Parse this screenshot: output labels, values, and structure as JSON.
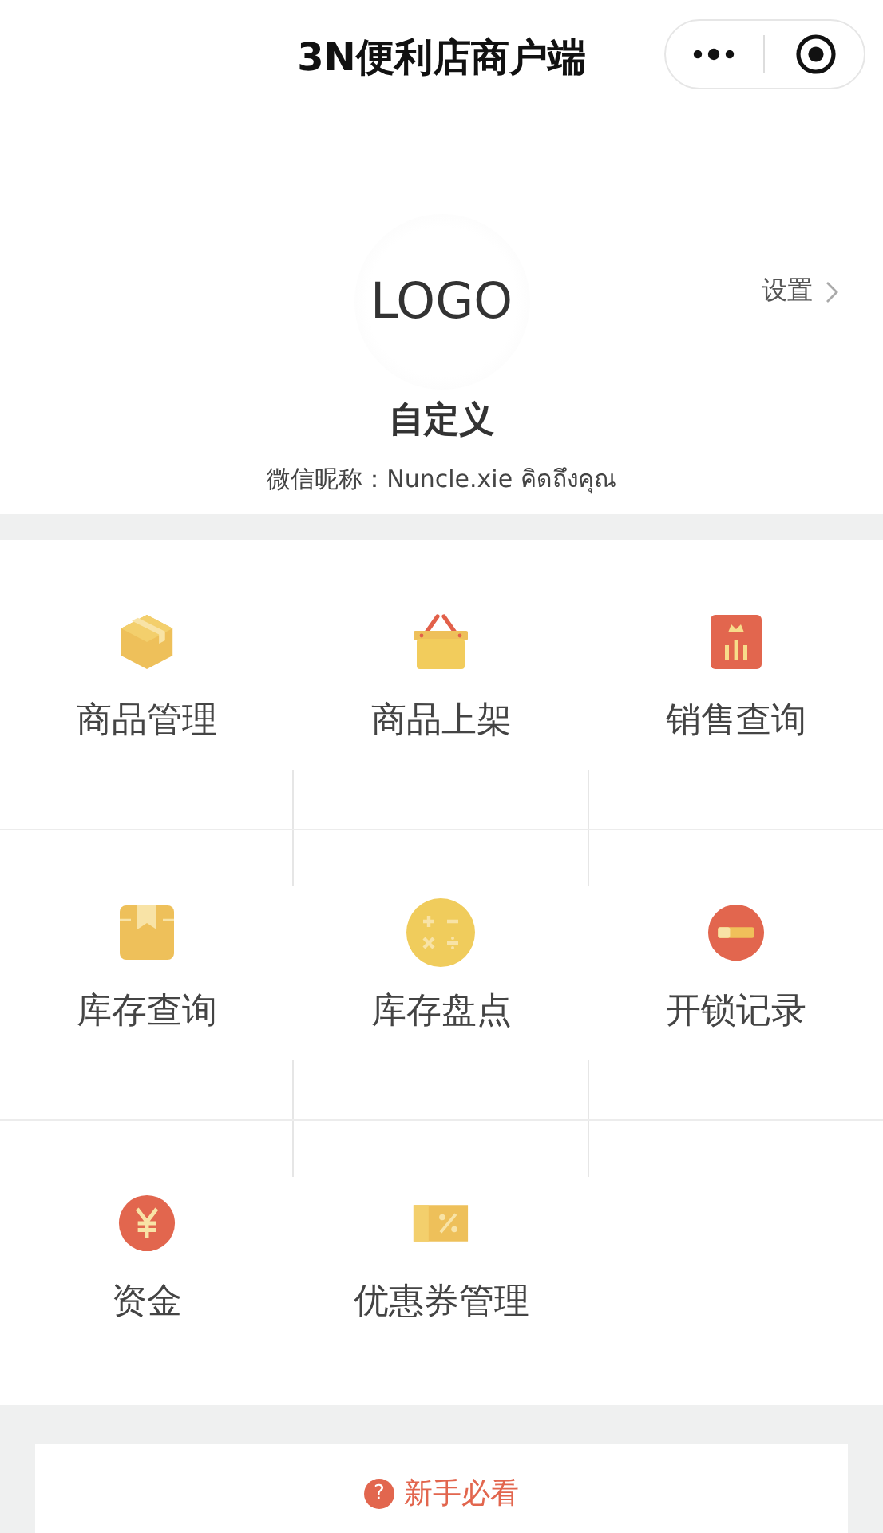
{
  "nav_bar": {
    "title": "3N便利店商户端"
  },
  "profile": {
    "logo_text": "LOGO",
    "settings_label": "设置",
    "name": "自定义",
    "nickname": "微信昵称：Nuncle.xie คิดถึงคุณ"
  },
  "menu_items": [
    {
      "label": "商品管理",
      "kind": "box"
    },
    {
      "label": "商品上架",
      "kind": "basket"
    },
    {
      "label": "销售查询",
      "kind": "chart"
    },
    {
      "label": "库存查询",
      "kind": "package"
    },
    {
      "label": "库存盘点",
      "kind": "calculator"
    },
    {
      "label": "开锁记录",
      "kind": "lock"
    },
    {
      "label": "资金",
      "kind": "yen"
    },
    {
      "label": "优惠券管理",
      "kind": "coupon"
    }
  ],
  "guide": {
    "icon_glyph": "?",
    "label": "新手必看"
  }
}
